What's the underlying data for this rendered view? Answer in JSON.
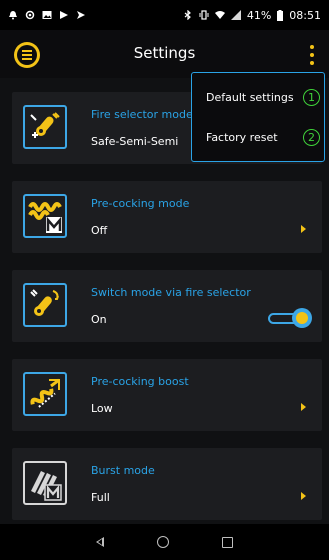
{
  "status_bar": {
    "battery": "41%",
    "time": "08:51",
    "icons": [
      "notification-icon",
      "settings-icon",
      "image-icon",
      "play-icon",
      "play-alt-icon",
      "bluetooth-icon",
      "vibrate-icon",
      "wifi-icon",
      "signal-icon",
      "battery-icon"
    ]
  },
  "app_bar": {
    "title": "Settings",
    "menu_icon": "menu-icon",
    "overflow_icon": "more-vert-icon"
  },
  "dropdown": {
    "items": [
      {
        "label": "Default settings",
        "marker": "1"
      },
      {
        "label": "Factory reset",
        "marker": "2"
      }
    ]
  },
  "settings": [
    {
      "title": "Fire selector mode",
      "value": "Safe-Semi-Semi",
      "icon": "fire-selector-icon",
      "control": "none"
    },
    {
      "title": "Pre-cocking mode",
      "value": "Off",
      "icon": "pre-cocking-icon",
      "control": "chevron"
    },
    {
      "title": "Switch mode via fire selector",
      "value": "On",
      "icon": "switch-mode-icon",
      "control": "toggle"
    },
    {
      "title": "Pre-cocking boost",
      "value": "Low",
      "icon": "pre-cocking-boost-icon",
      "control": "chevron"
    },
    {
      "title": "Burst mode",
      "value": "Full",
      "icon": "burst-mode-icon",
      "control": "chevron"
    }
  ],
  "colors": {
    "accent_blue": "#2aa3e6",
    "accent_yellow": "#f3c317",
    "marker_green": "#3fd13a",
    "card_bg": "#1c1d20"
  }
}
